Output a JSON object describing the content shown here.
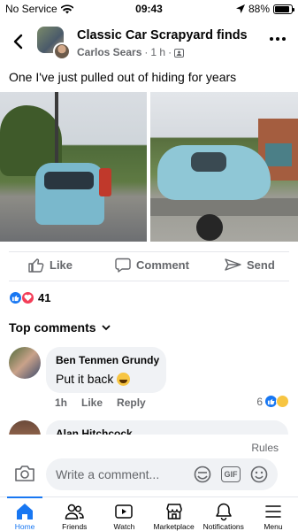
{
  "status_bar": {
    "carrier": "No Service",
    "time": "09:43",
    "battery": "88%",
    "battery_level": 0.88
  },
  "header": {
    "group_name": "Classic Car Scrapyard finds",
    "author": "Carlos Sears",
    "time_ago": "1 h"
  },
  "post": {
    "text": "One I've just pulled out of hiding for years"
  },
  "actions": {
    "like": "Like",
    "comment": "Comment",
    "share": "Send"
  },
  "reactions": {
    "count": "41"
  },
  "comments_header": "Top comments",
  "comments": [
    {
      "name": "Ben Tenmen Grundy",
      "text": "Put it back",
      "time": "1h",
      "like": "Like",
      "reply": "Reply",
      "reaction_count": "6"
    },
    {
      "name": "Alan Hitchcock"
    }
  ],
  "composer": {
    "rules": "Rules",
    "placeholder": "Write a comment...",
    "gif": "GIF"
  },
  "tabs": [
    {
      "label": "Home",
      "icon": "home-icon",
      "active": true
    },
    {
      "label": "Friends",
      "icon": "friends-icon"
    },
    {
      "label": "Watch",
      "icon": "watch-icon"
    },
    {
      "label": "Marketplace",
      "icon": "marketplace-icon"
    },
    {
      "label": "Notifications",
      "icon": "bell-icon"
    },
    {
      "label": "Menu",
      "icon": "menu-icon"
    }
  ],
  "colors": {
    "accent": "#1877f2",
    "love": "#f33e58",
    "secondary_text": "#65676b",
    "bubble": "#f0f2f5"
  }
}
